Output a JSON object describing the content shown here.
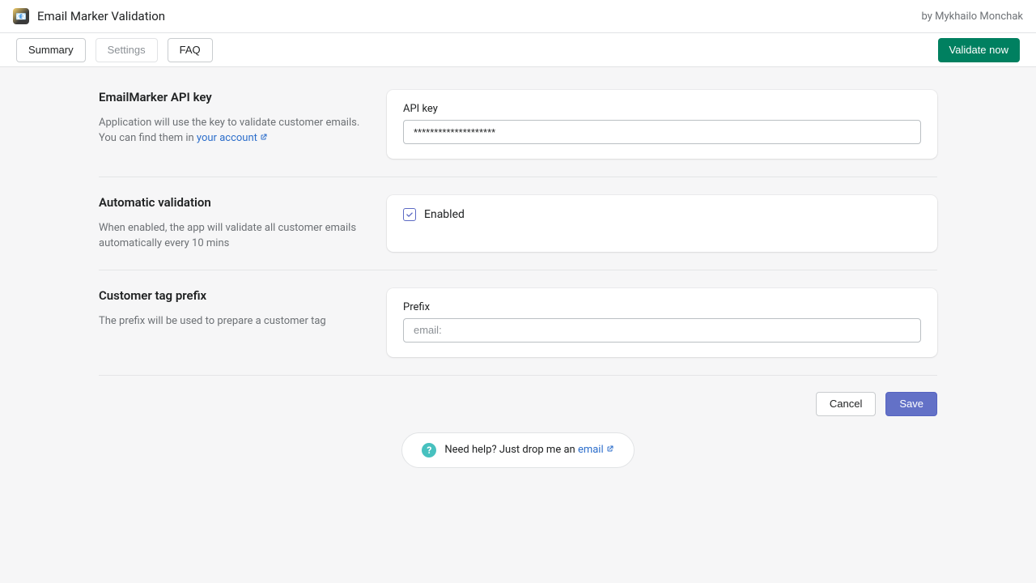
{
  "header": {
    "app_title": "Email Marker Validation",
    "byline": "by Mykhailo Monchak"
  },
  "tabs": {
    "summary": "Summary",
    "settings": "Settings",
    "faq": "FAQ"
  },
  "actions": {
    "validate_now": "Validate now",
    "cancel": "Cancel",
    "save": "Save"
  },
  "sections": {
    "api_key": {
      "title": "EmailMarker API key",
      "desc_pre": "Application will use the key to validate customer emails. You can find them in ",
      "link_text": "your account",
      "field_label": "API key",
      "value": "********************"
    },
    "auto": {
      "title": "Automatic validation",
      "desc": "When enabled, the app will validate all customer emails automatically every 10 mins",
      "checkbox_label": "Enabled",
      "checked": true
    },
    "prefix": {
      "title": "Customer tag prefix",
      "desc": "The prefix will be used to prepare a customer tag",
      "field_label": "Prefix",
      "placeholder": "email:"
    }
  },
  "help": {
    "text_pre": "Need help? Just drop me an ",
    "link_text": "email"
  }
}
